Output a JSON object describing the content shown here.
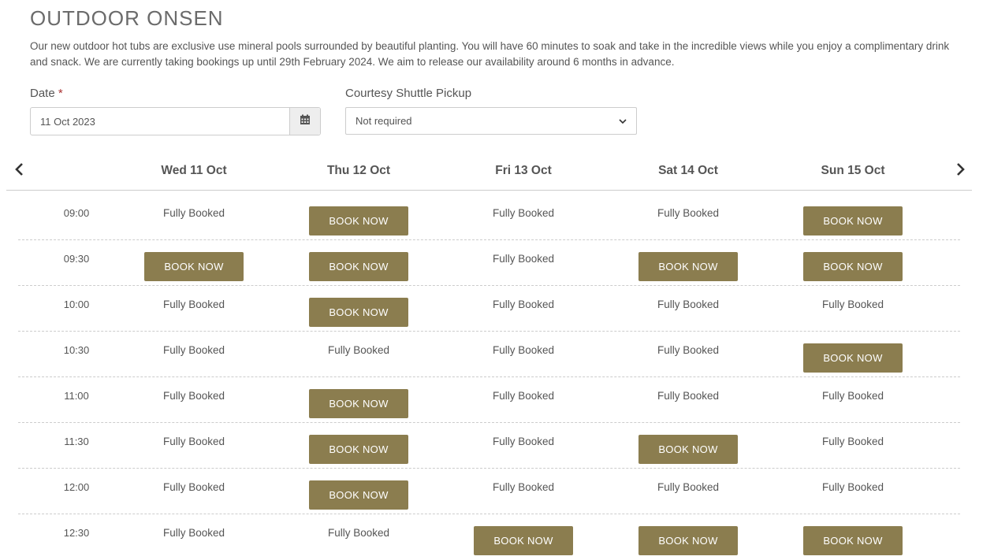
{
  "page": {
    "title": "OUTDOOR ONSEN",
    "description": "Our new outdoor hot tubs are exclusive use mineral pools surrounded by beautiful planting. You will have 60 minutes to soak and take in the incredible views while you enjoy a complimentary drink and snack. We are currently taking bookings up until 29th February 2024. We aim to release our availability around 6 months in advance."
  },
  "form": {
    "date_label": "Date",
    "required_mark": "*",
    "date_value": "11 Oct 2023",
    "date_icon": "calendar-icon",
    "shuttle_label": "Courtesy Shuttle Pickup",
    "shuttle_value": "Not required"
  },
  "nav": {
    "prev_icon": "chevron-left-icon",
    "next_icon": "chevron-right-icon"
  },
  "days": [
    "Wed 11 Oct",
    "Thu 12 Oct",
    "Fri 13 Oct",
    "Sat 14 Oct",
    "Sun 15 Oct"
  ],
  "labels": {
    "book": "BOOK NOW",
    "booked": "Fully Booked"
  },
  "accent_color": "#8b7d4f",
  "slots": [
    {
      "time": "09:00",
      "status": [
        "booked",
        "book",
        "booked",
        "booked",
        "book"
      ]
    },
    {
      "time": "09:30",
      "status": [
        "book",
        "book",
        "booked",
        "book",
        "book"
      ]
    },
    {
      "time": "10:00",
      "status": [
        "booked",
        "book",
        "booked",
        "booked",
        "booked"
      ]
    },
    {
      "time": "10:30",
      "status": [
        "booked",
        "booked",
        "booked",
        "booked",
        "book"
      ]
    },
    {
      "time": "11:00",
      "status": [
        "booked",
        "book",
        "booked",
        "booked",
        "booked"
      ]
    },
    {
      "time": "11:30",
      "status": [
        "booked",
        "book",
        "booked",
        "book",
        "booked"
      ]
    },
    {
      "time": "12:00",
      "status": [
        "booked",
        "book",
        "booked",
        "booked",
        "booked"
      ]
    },
    {
      "time": "12:30",
      "status": [
        "booked",
        "booked",
        "book",
        "book",
        "book"
      ]
    }
  ]
}
